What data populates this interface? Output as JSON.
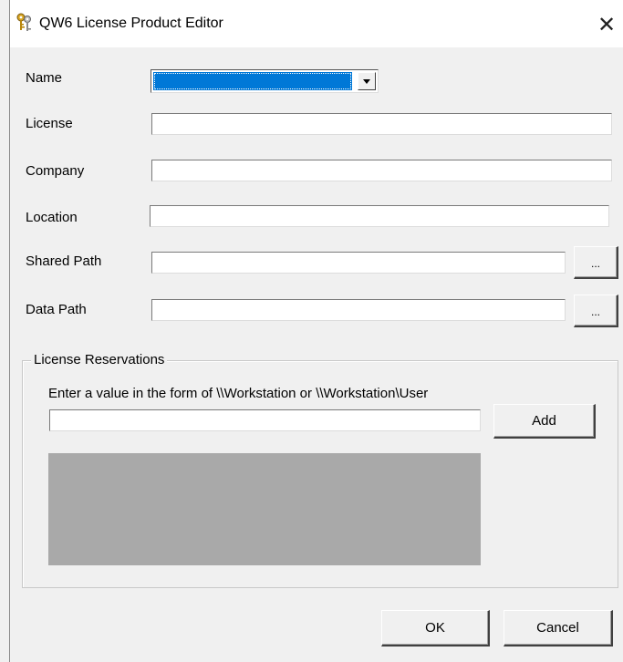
{
  "window": {
    "title": "QW6 License Product Editor",
    "close_symbol": "✕",
    "icon": "keys-icon"
  },
  "form": {
    "name": {
      "label": "Name",
      "value": ""
    },
    "license": {
      "label": "License",
      "value": ""
    },
    "company": {
      "label": "Company",
      "value": ""
    },
    "location": {
      "label": "Location",
      "value": ""
    },
    "shared_path": {
      "label": "Shared Path",
      "value": "",
      "browse_label": "..."
    },
    "data_path": {
      "label": "Data Path",
      "value": "",
      "browse_label": "..."
    }
  },
  "reservations": {
    "legend": "License Reservations",
    "hint": "Enter a value in the form of \\\\Workstation or \\\\Workstation\\User",
    "input_value": "",
    "add_label": "Add",
    "items": []
  },
  "footer": {
    "ok_label": "OK",
    "cancel_label": "Cancel"
  },
  "colors": {
    "selection": "#0078d7",
    "list_background": "#a9a9a9",
    "dialog_background": "#f0f0f0"
  }
}
